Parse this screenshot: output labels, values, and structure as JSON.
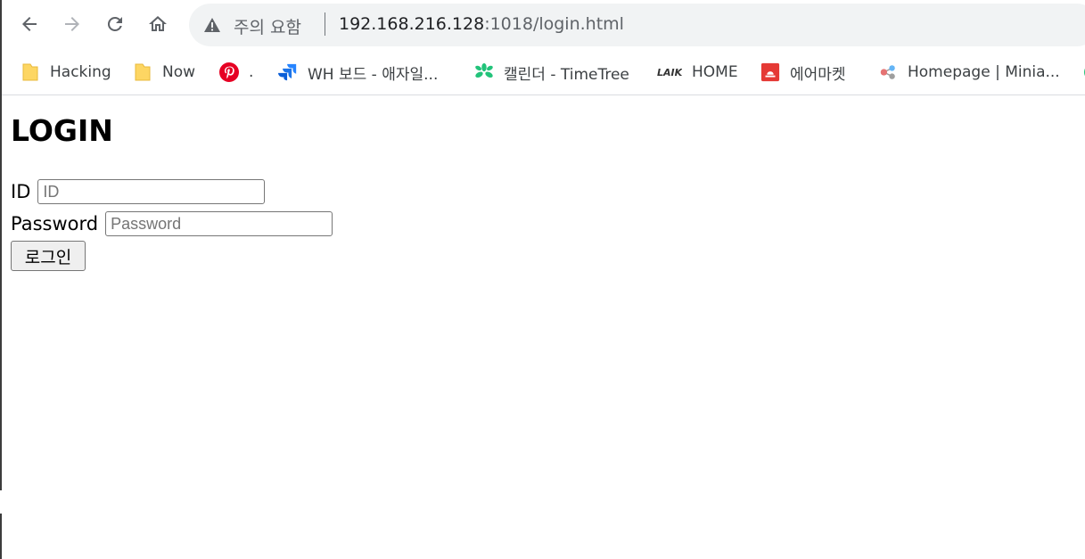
{
  "browser": {
    "security_status": "주의 요함",
    "url_host": "192.168.216.128",
    "url_rest": ":1018/login.html",
    "bookmarks": [
      {
        "label": "Hacking",
        "icon": "folder-icon"
      },
      {
        "label": "Now",
        "icon": "folder-icon"
      },
      {
        "label": ".",
        "icon": "pinterest-icon"
      },
      {
        "label": "WH 보드 - 애자일...",
        "icon": "jira-icon"
      },
      {
        "label": "캘린더 - TimeTree",
        "icon": "timetree-icon"
      },
      {
        "label": "HOME",
        "icon": "laika-logo-icon"
      },
      {
        "label": "에어마켓",
        "icon": "airmarket-icon"
      },
      {
        "label": "Homepage | Minia...",
        "icon": "molecule-icon"
      }
    ]
  },
  "page": {
    "title": "LOGIN",
    "id_label": "ID",
    "id_placeholder": "ID",
    "password_label": "Password",
    "password_placeholder": "Password",
    "login_button": "로그인"
  },
  "colors": {
    "omnibox_bg": "#f1f3f4",
    "folder": "#fdd663",
    "pinterest": "#e60023",
    "jira": "#2684ff",
    "timetree": "#22c37a",
    "airmarket": "#e53935"
  }
}
